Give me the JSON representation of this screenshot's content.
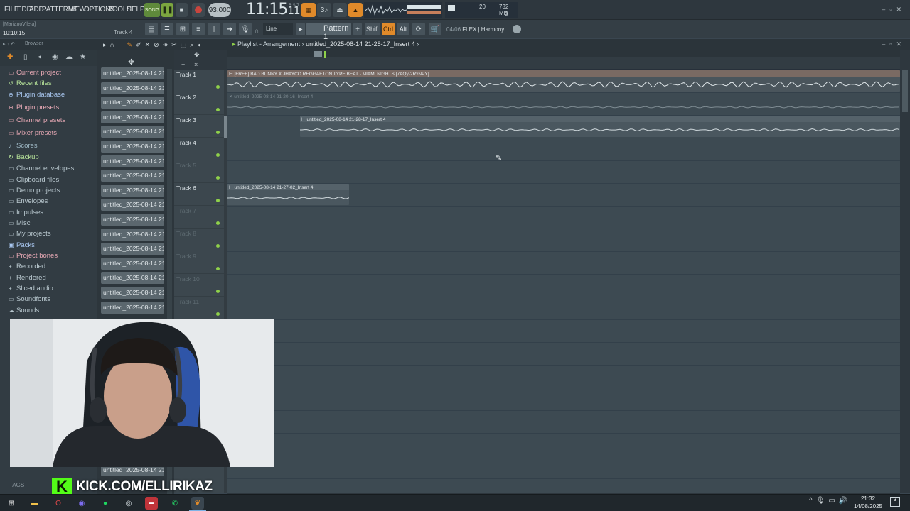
{
  "menu": {
    "items": [
      "FILE",
      "EDIT",
      "ADD",
      "PATTERNS",
      "VIEW",
      "OPTIONS",
      "TOOLS",
      "HELP"
    ]
  },
  "transport": {
    "song_label": "SONG",
    "tempo": "93.000",
    "clock": "11:15",
    "clock_frac": "11",
    "clock_sub": "B:S:T"
  },
  "status": {
    "cpu_value": "20",
    "memory": "732 MB",
    "voices": "3"
  },
  "hint_bar": {
    "user": "[MarianoVilela]",
    "time": "10:10:15",
    "track": "Track 4"
  },
  "toolbar2": {
    "snap": "Line",
    "pattern": "Pattern 1",
    "shift": "Shift",
    "ctrl": "Ctrl",
    "alt": "Alt",
    "flex_count": "04/06",
    "flex_name": "FLEX | Harmony"
  },
  "browser": {
    "title": "Browser",
    "tags_label": "TAGS",
    "items": [
      {
        "label": "Current project",
        "color": "#e6a8b4",
        "icon": "folder-icon"
      },
      {
        "label": "Recent files",
        "color": "#b7e39a",
        "icon": "recent-icon"
      },
      {
        "label": "Plugin database",
        "color": "#a9c7f0",
        "icon": "plug-icon"
      },
      {
        "label": "Plugin presets",
        "color": "#e6a8b4",
        "icon": "plug-icon"
      },
      {
        "label": "Channel presets",
        "color": "#e6a8b4",
        "icon": "folder-icon"
      },
      {
        "label": "Mixer presets",
        "color": "#e6a8b4",
        "icon": "folder-icon"
      },
      {
        "label": "Scores",
        "color": "#9fb9c6",
        "icon": "note-icon"
      },
      {
        "label": "Backup",
        "color": "#b7e39a",
        "icon": "backup-icon"
      },
      {
        "label": "Channel envelopes",
        "color": "#b9c8cf",
        "icon": "folder-icon"
      },
      {
        "label": "Clipboard files",
        "color": "#b9c8cf",
        "icon": "folder-icon"
      },
      {
        "label": "Demo projects",
        "color": "#b9c8cf",
        "icon": "folder-icon"
      },
      {
        "label": "Envelopes",
        "color": "#b9c8cf",
        "icon": "folder-icon"
      },
      {
        "label": "Impulses",
        "color": "#b9c8cf",
        "icon": "folder-icon"
      },
      {
        "label": "Misc",
        "color": "#b9c8cf",
        "icon": "folder-icon"
      },
      {
        "label": "My projects",
        "color": "#b9c8cf",
        "icon": "folder-icon"
      },
      {
        "label": "Packs",
        "color": "#a9c7f0",
        "icon": "pack-icon"
      },
      {
        "label": "Project bones",
        "color": "#e6a8b4",
        "icon": "folder-icon"
      },
      {
        "label": "Recorded",
        "color": "#b9c8cf",
        "icon": "plus-icon"
      },
      {
        "label": "Rendered",
        "color": "#b9c8cf",
        "icon": "plus-icon"
      },
      {
        "label": "Sliced audio",
        "color": "#b9c8cf",
        "icon": "plus-icon"
      },
      {
        "label": "Soundfonts",
        "color": "#b9c8cf",
        "icon": "folder-icon"
      },
      {
        "label": "Sounds",
        "color": "#b9c8cf",
        "icon": "cloud-icon"
      }
    ]
  },
  "channels": [
    "untitled_2025-08-14 21-...",
    "untitled_2025-08-14 21-...",
    "untitled_2025-08-14 21-...",
    "untitled_2025-08-14 21-...",
    "untitled_2025-08-14 21-...",
    "untitled_2025-08-14 21-...",
    "untitled_2025-08-14 21-...",
    "untitled_2025-08-14 21-...",
    "untitled_2025-08-14 21-...",
    "untitled_2025-08-14 21-...",
    "untitled_2025-08-14 21-...",
    "untitled_2025-08-14 21-...",
    "untitled_2025-08-14 21-...",
    "untitled_2025-08-14 21-...",
    "untitled_2025-08-14 21-...",
    "untitled_2025-08-14 21-...",
    "untitled_2025-08-14 21-..."
  ],
  "channel_bottom": "untitled_2025-08-14 21-...",
  "playlist": {
    "title": "Playlist - Arrangement",
    "breadcrumb": "untitled_2025-08-14 21-28-17_Insert 4",
    "tracks": [
      {
        "name": "Track 1",
        "dim": false
      },
      {
        "name": "Track 2",
        "dim": false
      },
      {
        "name": "Track 3",
        "dim": false
      },
      {
        "name": "Track 4",
        "dim": false
      },
      {
        "name": "Track 5",
        "dim": true
      },
      {
        "name": "Track 6",
        "dim": false
      },
      {
        "name": "Track 7",
        "dim": true
      },
      {
        "name": "Track 8",
        "dim": true
      },
      {
        "name": "Track 9",
        "dim": true
      },
      {
        "name": "Track 10",
        "dim": true
      },
      {
        "name": "Track 11",
        "dim": true
      }
    ],
    "clips": [
      {
        "label": "[FREE] BAD BUNNY X JHAYCO REGGAETON TYPE BEAT - MIAMI NIGHTS [7AQy-2RxNPY]",
        "muted": false
      },
      {
        "label": "untitled_2025-08-14 21-20-16_Insert 4",
        "muted": true
      },
      {
        "label": "untitled_2025-08-14 21-28-17_Insert 4",
        "muted": false
      },
      {
        "label": "untitled_2025-08-14 21-27-02_Insert 4",
        "muted": false
      }
    ]
  },
  "stream": {
    "kick_url": "KICK.COM/ELLIRIKAZ"
  },
  "taskbar": {
    "time": "21:32",
    "date": "14/08/2025",
    "notifications": "3"
  }
}
